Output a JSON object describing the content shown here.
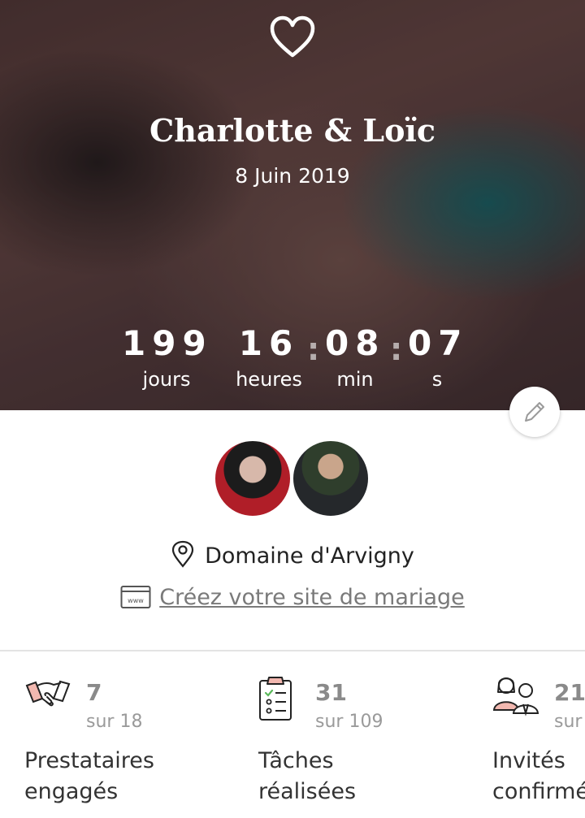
{
  "header": {
    "couple_names": "Charlotte & Loïc",
    "wedding_date": "8 Juin 2019"
  },
  "countdown": {
    "days": "199",
    "days_label": "jours",
    "hours": "16",
    "hours_label": "heures",
    "minutes": "08",
    "minutes_label": "min",
    "seconds": "07",
    "seconds_label": "s",
    "separator": ":"
  },
  "location": "Domaine d'Arvigny",
  "website_link": "Créez votre site de mariage",
  "icons": {
    "heart": "heart-outline-icon",
    "edit": "pencil-icon",
    "location": "map-pin-icon",
    "website": "www-browser-icon",
    "vendors": "handshake-icon",
    "tasks": "checklist-icon",
    "guests": "guests-icon"
  },
  "stats": [
    {
      "value": "7",
      "total": "sur 18",
      "label_line1": "Prestataires",
      "label_line2": "engagés"
    },
    {
      "value": "31",
      "total": "sur 109",
      "label_line1": "Tâches",
      "label_line2": "réalisées"
    },
    {
      "value": "21",
      "total": "sur",
      "label_line1": "Invités",
      "label_line2": "confirmés"
    }
  ],
  "colors": {
    "accent_pink": "#f2b8b0",
    "text_dark": "#222222",
    "muted": "#8a8a8a"
  }
}
